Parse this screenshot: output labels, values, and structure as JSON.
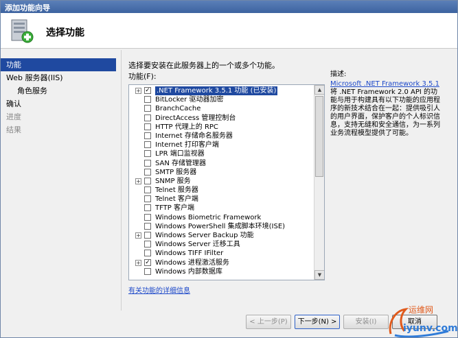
{
  "window": {
    "title": "添加功能向导"
  },
  "header": {
    "title": "选择功能"
  },
  "nav": {
    "items": [
      {
        "label": "功能",
        "state": "active"
      },
      {
        "label": "Web 服务器(IIS)",
        "state": "normal",
        "indent": false
      },
      {
        "label": "角色服务",
        "state": "normal",
        "indent": true
      },
      {
        "label": "确认",
        "state": "normal",
        "indent": false
      },
      {
        "label": "进度",
        "state": "disabled",
        "indent": false
      },
      {
        "label": "结果",
        "state": "disabled",
        "indent": false
      }
    ]
  },
  "main": {
    "instruction": "选择要安装在此服务器上的一个或多个功能。",
    "features_label": "功能(F):",
    "features": [
      {
        "label": ".NET Framework 3.5.1 功能  (已安装)",
        "expandable": true,
        "checked": true,
        "selected": true
      },
      {
        "label": "BitLocker 驱动器加密",
        "expandable": false,
        "checked": false
      },
      {
        "label": "BranchCache",
        "expandable": false,
        "checked": false
      },
      {
        "label": "DirectAccess 管理控制台",
        "expandable": false,
        "checked": false
      },
      {
        "label": "HTTP 代理上的 RPC",
        "expandable": false,
        "checked": false
      },
      {
        "label": "Internet 存储命名服务器",
        "expandable": false,
        "checked": false
      },
      {
        "label": "Internet 打印客户端",
        "expandable": false,
        "checked": false
      },
      {
        "label": "LPR 端口监视器",
        "expandable": false,
        "checked": false
      },
      {
        "label": "SAN 存储管理器",
        "expandable": false,
        "checked": false
      },
      {
        "label": "SMTP 服务器",
        "expandable": false,
        "checked": false
      },
      {
        "label": "SNMP 服务",
        "expandable": true,
        "checked": false
      },
      {
        "label": "Telnet 服务器",
        "expandable": false,
        "checked": false
      },
      {
        "label": "Telnet 客户端",
        "expandable": false,
        "checked": false
      },
      {
        "label": "TFTP 客户端",
        "expandable": false,
        "checked": false
      },
      {
        "label": "Windows Biometric Framework",
        "expandable": false,
        "checked": false
      },
      {
        "label": "Windows PowerShell 集成脚本环境(ISE)",
        "expandable": false,
        "checked": false
      },
      {
        "label": "Windows Server Backup 功能",
        "expandable": true,
        "checked": false
      },
      {
        "label": "Windows Server 迁移工具",
        "expandable": false,
        "checked": false
      },
      {
        "label": "Windows TIFF IFilter",
        "expandable": false,
        "checked": false
      },
      {
        "label": "Windows 进程激活服务",
        "expandable": true,
        "checked": true
      },
      {
        "label": "Windows 内部数据库",
        "expandable": false,
        "checked": false
      }
    ],
    "more_info_link": "有关功能的详细信息",
    "description_label": "描述:",
    "description_link": "Microsoft .NET Framework 3.5.1",
    "description_text": "将 .NET Framework 2.0 API 的功能与用于构建具有以下功能的应用程序的新技术结合在一起：提供吸引人的用户界面，保护客户的个人标识信息，支持无缝和安全通信，为一系列业务流程模型提供了可能。"
  },
  "footer": {
    "prev_label": "< 上一步(P)",
    "next_label": "下一步(N) >",
    "install_label": "安装(I)",
    "cancel_label": "取消"
  },
  "watermark": {
    "text_cn": "运维网",
    "text_en": "iyunv.com"
  },
  "colors": {
    "accent": "#1f49a0",
    "link": "#1c48c9",
    "titlebar": "#3d63a0"
  }
}
